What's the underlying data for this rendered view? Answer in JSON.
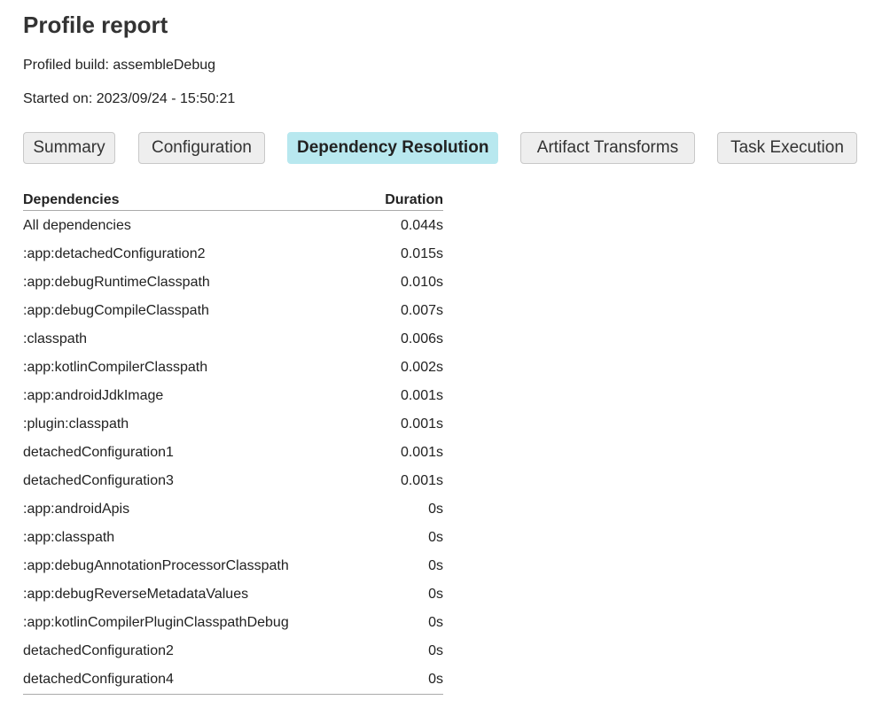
{
  "page": {
    "title": "Profile report",
    "profiled_build": "Profiled build: assembleDebug",
    "started_on": "Started on: 2023/09/24 - 15:50:21"
  },
  "tabs": [
    {
      "label": "Summary",
      "active": false
    },
    {
      "label": "Configuration",
      "active": false
    },
    {
      "label": "Dependency Resolution",
      "active": true
    },
    {
      "label": "Artifact Transforms",
      "active": false
    },
    {
      "label": "Task Execution",
      "active": false
    }
  ],
  "colors": {
    "active_tab": "#b8e8ef",
    "inactive_tab": "#eeeeee"
  },
  "table": {
    "headers": {
      "name": "Dependencies",
      "duration": "Duration"
    },
    "rows": [
      {
        "name": "All dependencies",
        "duration": "0.044s"
      },
      {
        "name": ":app:detachedConfiguration2",
        "duration": "0.015s"
      },
      {
        "name": ":app:debugRuntimeClasspath",
        "duration": "0.010s"
      },
      {
        "name": ":app:debugCompileClasspath",
        "duration": "0.007s"
      },
      {
        "name": ":classpath",
        "duration": "0.006s"
      },
      {
        "name": ":app:kotlinCompilerClasspath",
        "duration": "0.002s"
      },
      {
        "name": ":app:androidJdkImage",
        "duration": "0.001s"
      },
      {
        "name": ":plugin:classpath",
        "duration": "0.001s"
      },
      {
        "name": "detachedConfiguration1",
        "duration": "0.001s"
      },
      {
        "name": "detachedConfiguration3",
        "duration": "0.001s"
      },
      {
        "name": ":app:androidApis",
        "duration": "0s"
      },
      {
        "name": ":app:classpath",
        "duration": "0s"
      },
      {
        "name": ":app:debugAnnotationProcessorClasspath",
        "duration": "0s"
      },
      {
        "name": ":app:debugReverseMetadataValues",
        "duration": "0s"
      },
      {
        "name": ":app:kotlinCompilerPluginClasspathDebug",
        "duration": "0s"
      },
      {
        "name": "detachedConfiguration2",
        "duration": "0s"
      },
      {
        "name": "detachedConfiguration4",
        "duration": "0s"
      }
    ]
  }
}
